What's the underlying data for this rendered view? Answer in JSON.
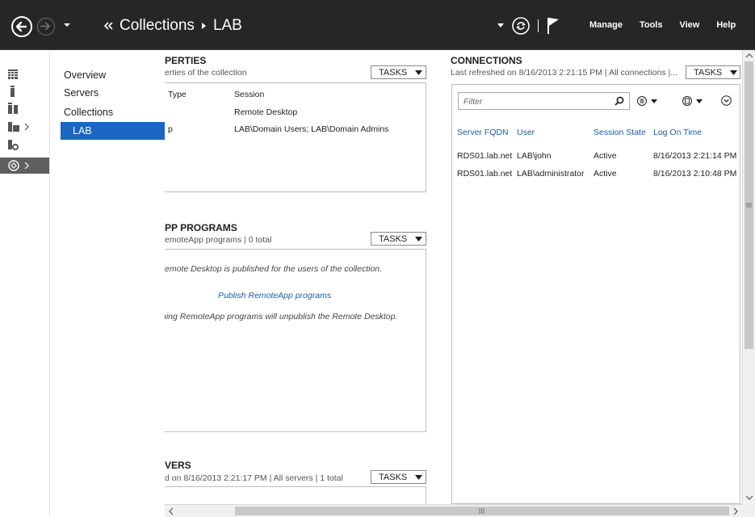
{
  "titlebar": {
    "breadcrumb": [
      "Collections",
      "LAB"
    ],
    "menus": [
      "Manage",
      "Tools",
      "View",
      "Help"
    ]
  },
  "iconbar": {
    "icons": [
      "dashboard-icon",
      "local-server-icon",
      "all-servers-icon",
      "file-storage-icon",
      "iis-icon",
      "remote-desktop-services-icon"
    ]
  },
  "flyout": {
    "items": [
      "Overview",
      "Servers",
      "Collections",
      "LAB"
    ]
  },
  "properties": {
    "title": "PERTIES",
    "subtitle": "erties of the collection",
    "tasks_label": "TASKS",
    "rows": [
      {
        "key": "Type",
        "value": "Session"
      },
      {
        "key": "",
        "value": "Remote Desktop"
      },
      {
        "key": "p",
        "value": "LAB\\Domain Users; LAB\\Domain Admins"
      }
    ]
  },
  "remoteapp": {
    "title": "PP PROGRAMS",
    "subtitle": "emoteApp programs | 0 total",
    "tasks_label": "TASKS",
    "note1": "emote Desktop is published for the users of the collection.",
    "link": "Publish RemoteApp programs",
    "note2": "hing RemoteApp programs will unpublish the Remote Desktop."
  },
  "servers": {
    "title": "VERS",
    "subtitle": "d on 8/16/2013 2:21:17 PM | All servers | 1 total",
    "tasks_label": "TASKS"
  },
  "connections": {
    "title": "CONNECTIONS",
    "subtitle": "Last refreshed on 8/16/2013 2:21:15 PM | All connections |...",
    "tasks_label": "TASKS",
    "filter_placeholder": "Filter",
    "columns": [
      "Server FQDN",
      "User",
      "Session State",
      "Log On Time"
    ],
    "rows": [
      [
        "RDS01.lab.net",
        "LAB\\john",
        "Active",
        "8/16/2013 2:21:14 PM"
      ],
      [
        "RDS01.lab.net",
        "LAB\\administrator",
        "Active",
        "8/16/2013 2:10:48 PM"
      ]
    ]
  },
  "colors": {
    "titlebar": "#262626",
    "accent": "#1a66c2",
    "link": "#1a5ea8"
  }
}
